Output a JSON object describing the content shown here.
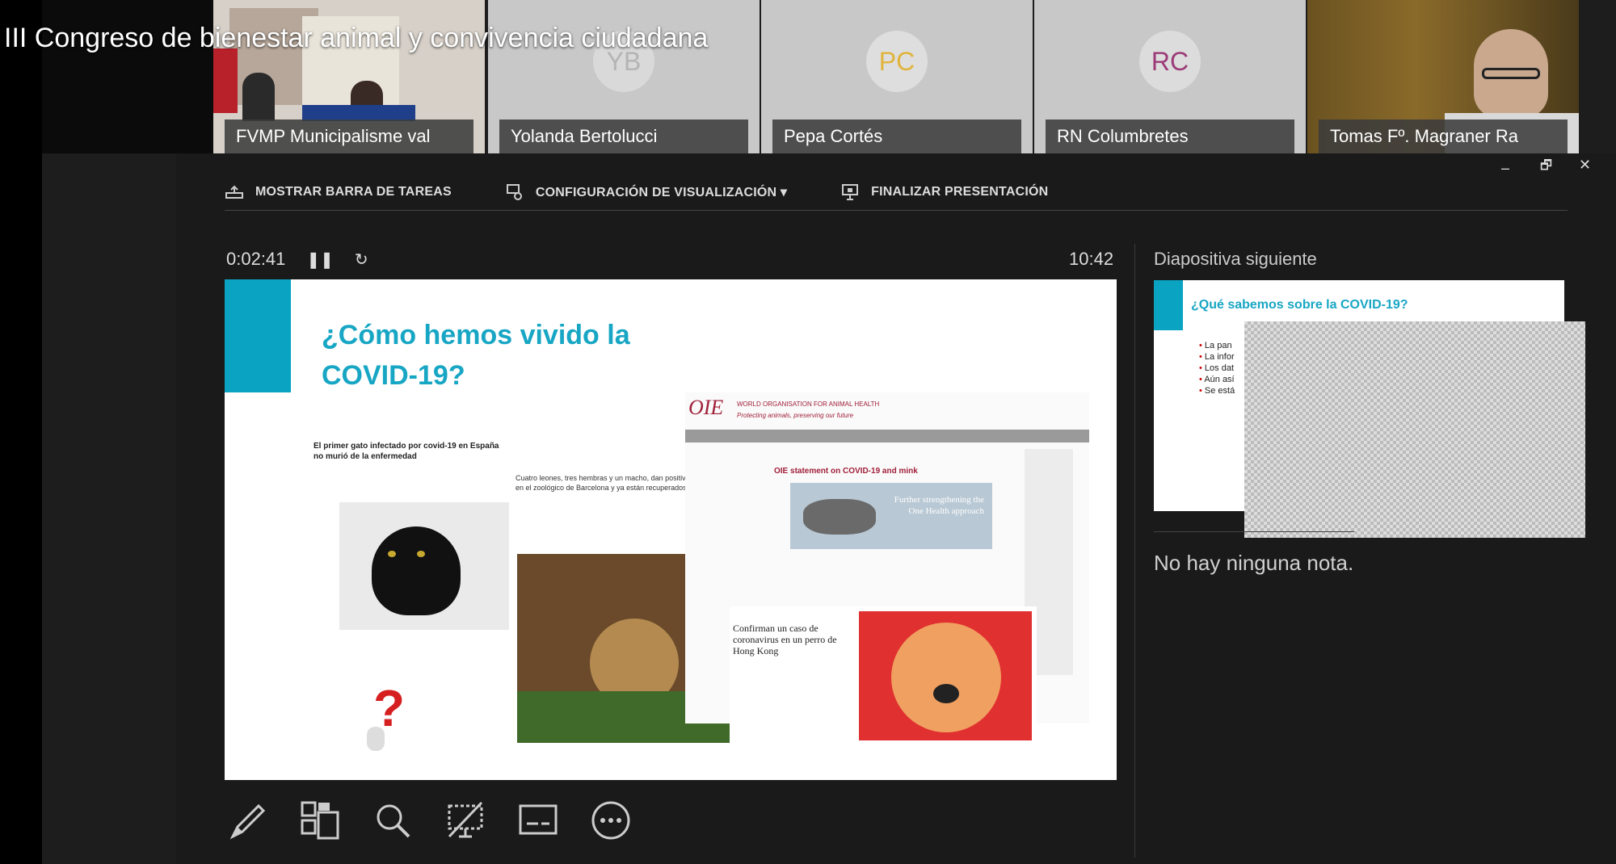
{
  "video_title": "III Congreso de bienestar animal y convivencia ciudadana",
  "participants": [
    {
      "name": "FVMP Municipalisme val",
      "initials": ""
    },
    {
      "name": "Yolanda Bertolucci",
      "initials": "YB"
    },
    {
      "name": "Pepa Cortés",
      "initials": "PC"
    },
    {
      "name": "RN Columbretes",
      "initials": "RC"
    },
    {
      "name": "Tomas Fº. Magraner Ra",
      "initials": ""
    }
  ],
  "toolbar": {
    "taskbar_label": "MOSTRAR BARRA DE TAREAS",
    "display_label": "CONFIGURACIÓN DE VISUALIZACIÓN ▾",
    "end_label": "FINALIZAR PRESENTACIÓN"
  },
  "window_controls": {
    "minimize": "–",
    "restore": "🗗",
    "close": "✕"
  },
  "timer": "0:02:41",
  "clock": "10:42",
  "slide": {
    "title_line1": "¿Cómo hemos vivido la",
    "title_line2": "COVID-19?",
    "cat_headline": "El primer gato infectado por covid-19 en España no murió de la enfermedad",
    "lion_caption": "Cuatro leones, tres hembras y un macho, dan positivo a covid-19 en el zoológico de Barcelona y ya están recuperados",
    "oie_org": "WORLD ORGANISATION FOR ANIMAL HEALTH",
    "oie_tagline": "Protecting animals, preserving our future",
    "oie_statement": "OIE statement on COVID-19 and mink",
    "oie_banner": "Further strengthening the One Health approach",
    "dog_headline": "Confirman un caso de coronavirus en un perro de Hong Kong"
  },
  "next_slide": {
    "label": "Diapositiva siguiente",
    "title": "¿Qué sabemos sobre la COVID-19?",
    "bullets": [
      "La pan",
      "La infor",
      "Los dat",
      "Aún así",
      "Se está"
    ]
  },
  "notes": "No hay ninguna nota.",
  "tools": [
    "pen-tool",
    "grid-view",
    "zoom",
    "pointer-screen",
    "subtitles",
    "more-options"
  ]
}
